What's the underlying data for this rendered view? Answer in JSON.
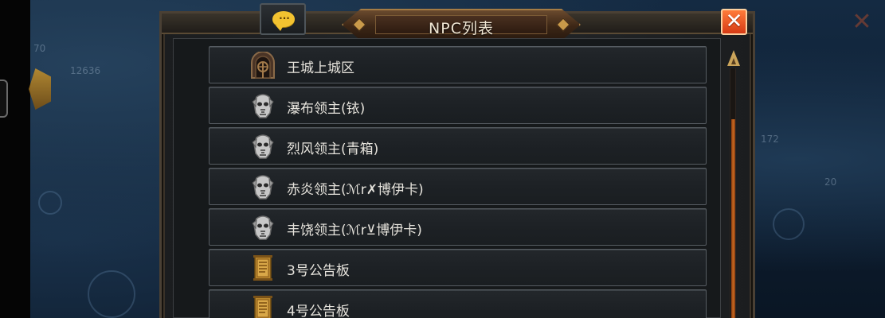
{
  "window": {
    "title": "NPC列表"
  },
  "background": {
    "left_text_1": "70",
    "left_text_2": "12636",
    "right_text_1": "172",
    "right_text_2": "20"
  },
  "npc_list": {
    "items": [
      {
        "label": "王城上城区",
        "icon": "gate-icon"
      },
      {
        "label": "瀑布领主(铱)",
        "icon": "skull-mask-icon"
      },
      {
        "label": "烈风领主(青箱)",
        "icon": "skull-mask-icon"
      },
      {
        "label": "赤炎领主(ℳr✗博伊卡)",
        "icon": "skull-mask-icon"
      },
      {
        "label": "丰饶领主(ℳr⊻博伊卡)",
        "icon": "skull-mask-icon"
      },
      {
        "label": "3号公告板",
        "icon": "notice-board-icon"
      },
      {
        "label": "4号公告板",
        "icon": "notice-board-icon"
      }
    ]
  },
  "colors": {
    "accent": "#d63b15",
    "title_plate": "#3d2716",
    "scroll_thumb": "#c76a20",
    "chat_icon": "#f2c230"
  }
}
